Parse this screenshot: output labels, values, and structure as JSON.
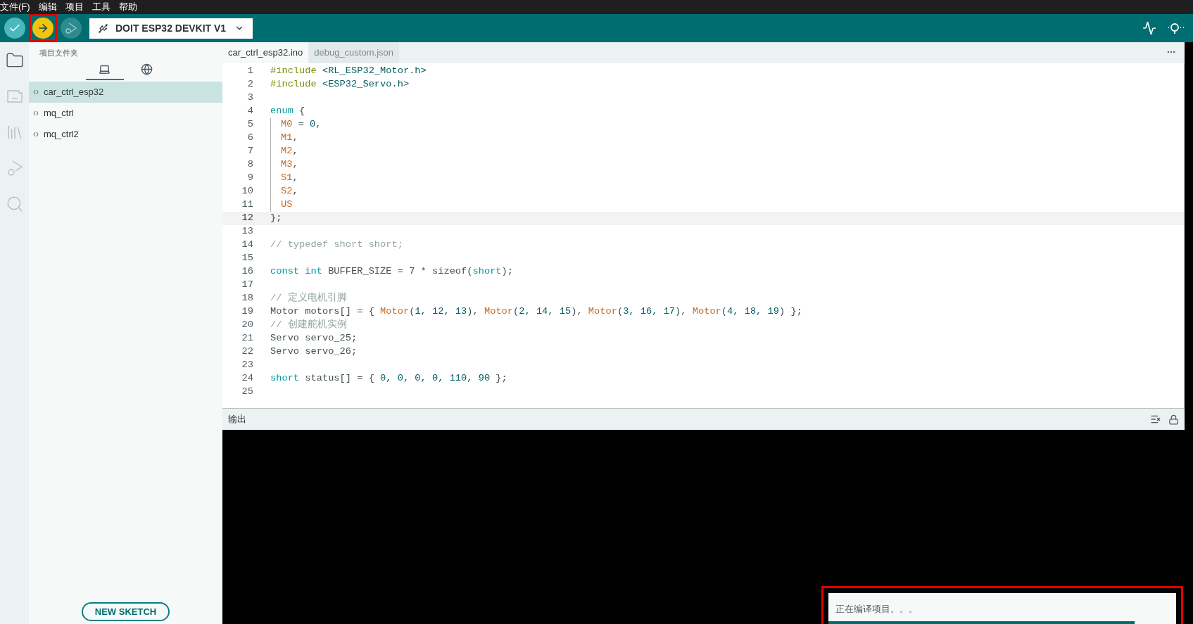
{
  "menu": [
    "文件(F)",
    "编辑",
    "项目",
    "工具",
    "帮助"
  ],
  "toolbar": {
    "buttons": [
      {
        "kind": "verify",
        "annotated": false
      },
      {
        "kind": "upload",
        "annotated": true
      },
      {
        "kind": "debug",
        "annotated": false
      }
    ],
    "board": "DOIT ESP32 DEVKIT V1"
  },
  "activity_bar": [
    {
      "kind": "folder",
      "selected": true
    },
    {
      "kind": "board",
      "selected": false
    },
    {
      "kind": "library",
      "selected": false
    },
    {
      "kind": "debug",
      "selected": false
    },
    {
      "kind": "search",
      "selected": false
    }
  ],
  "sidebar": {
    "title": "项目文件夹",
    "tabs": [
      {
        "kind": "local",
        "selected": true
      },
      {
        "kind": "cloud",
        "selected": false
      }
    ],
    "items": [
      {
        "label": "car_ctrl_esp32",
        "selected": true
      },
      {
        "label": "mq_ctrl",
        "selected": false
      },
      {
        "label": "mq_ctrl2",
        "selected": false
      }
    ],
    "new_button": "NEW SKETCH"
  },
  "editor": {
    "tabs": [
      {
        "label": "car_ctrl_esp32.ino",
        "selected": true
      },
      {
        "label": "debug_custom.json",
        "selected": false
      }
    ],
    "lines": [
      {
        "number": "1",
        "current": false,
        "indent": false,
        "tokens": [
          {
            "kind": "preproc",
            "text": "#include"
          },
          {
            "kind": "header",
            "text": " <RL_ESP32_Motor.h>"
          }
        ]
      },
      {
        "number": "2",
        "current": false,
        "indent": false,
        "tokens": [
          {
            "kind": "preproc",
            "text": "#include"
          },
          {
            "kind": "header",
            "text": " <ESP32_Servo.h>"
          }
        ]
      },
      {
        "number": "3",
        "current": false,
        "indent": false
      },
      {
        "number": "4",
        "current": false,
        "indent": false,
        "tokens": [
          {
            "kind": "keyword",
            "text": "enum"
          },
          {
            "kind": "plain",
            "text": " {"
          }
        ]
      },
      {
        "number": "5",
        "current": false,
        "indent": true,
        "tokens": [
          {
            "kind": "constant",
            "text": "M0"
          },
          {
            "kind": "plain",
            "text": " = "
          },
          {
            "kind": "number",
            "text": "0"
          },
          {
            "kind": "plain",
            "text": ","
          }
        ]
      },
      {
        "number": "6",
        "current": false,
        "indent": true,
        "tokens": [
          {
            "kind": "constant",
            "text": "M1"
          },
          {
            "kind": "plain",
            "text": ","
          }
        ]
      },
      {
        "number": "7",
        "current": false,
        "indent": true,
        "tokens": [
          {
            "kind": "constant",
            "text": "M2"
          },
          {
            "kind": "plain",
            "text": ","
          }
        ]
      },
      {
        "number": "8",
        "current": false,
        "indent": true,
        "tokens": [
          {
            "kind": "constant",
            "text": "M3"
          },
          {
            "kind": "plain",
            "text": ","
          }
        ]
      },
      {
        "number": "9",
        "current": false,
        "indent": true,
        "tokens": [
          {
            "kind": "constant",
            "text": "S1"
          },
          {
            "kind": "plain",
            "text": ","
          }
        ]
      },
      {
        "number": "10",
        "current": false,
        "indent": true,
        "tokens": [
          {
            "kind": "constant",
            "text": "S2"
          },
          {
            "kind": "plain",
            "text": ","
          }
        ]
      },
      {
        "number": "11",
        "current": false,
        "indent": true,
        "tokens": [
          {
            "kind": "constant",
            "text": "US"
          }
        ]
      },
      {
        "number": "12",
        "current": true,
        "indent": false,
        "tokens": [
          {
            "kind": "plain",
            "text": "};"
          }
        ]
      },
      {
        "number": "13",
        "current": false,
        "indent": false
      },
      {
        "number": "14",
        "current": false,
        "indent": false,
        "tokens": [
          {
            "kind": "comment",
            "text": "// typedef short short;"
          }
        ]
      },
      {
        "number": "15",
        "current": false,
        "indent": false
      },
      {
        "number": "16",
        "current": false,
        "indent": false,
        "tokens": [
          {
            "kind": "keyword",
            "text": "const int"
          },
          {
            "kind": "plain",
            "text": " BUFFER_SIZE = 7 * sizeof("
          },
          {
            "kind": "keyword",
            "text": "short"
          },
          {
            "kind": "plain",
            "text": ");"
          }
        ]
      },
      {
        "number": "17",
        "current": false,
        "indent": false
      },
      {
        "number": "18",
        "current": false,
        "indent": false,
        "tokens": [
          {
            "kind": "comment",
            "text": "// 定义电机引脚"
          }
        ]
      },
      {
        "number": "19",
        "current": false,
        "indent": false,
        "tokens": [
          {
            "kind": "plain",
            "text": "Motor motors[] = { "
          },
          {
            "kind": "constant",
            "text": "Motor"
          },
          {
            "kind": "plain",
            "text": "("
          },
          {
            "kind": "number",
            "text": "1, 12, 13"
          },
          {
            "kind": "plain",
            "text": "), "
          },
          {
            "kind": "constant",
            "text": "Motor"
          },
          {
            "kind": "plain",
            "text": "("
          },
          {
            "kind": "number",
            "text": "2, 14, 15"
          },
          {
            "kind": "plain",
            "text": "), "
          },
          {
            "kind": "constant",
            "text": "Motor"
          },
          {
            "kind": "plain",
            "text": "("
          },
          {
            "kind": "number",
            "text": "3, 16, 17"
          },
          {
            "kind": "plain",
            "text": "), "
          },
          {
            "kind": "constant",
            "text": "Motor"
          },
          {
            "kind": "plain",
            "text": "("
          },
          {
            "kind": "number",
            "text": "4, 18, 19"
          },
          {
            "kind": "plain",
            "text": ") };"
          }
        ]
      },
      {
        "number": "20",
        "current": false,
        "indent": false,
        "tokens": [
          {
            "kind": "comment",
            "text": "// 创建舵机实例"
          }
        ]
      },
      {
        "number": "21",
        "current": false,
        "indent": false,
        "tokens": [
          {
            "kind": "plain",
            "text": "Servo servo_25;"
          }
        ]
      },
      {
        "number": "22",
        "current": false,
        "indent": false,
        "tokens": [
          {
            "kind": "plain",
            "text": "Servo servo_26;"
          }
        ]
      },
      {
        "number": "23",
        "current": false,
        "indent": false
      },
      {
        "number": "24",
        "current": false,
        "indent": false,
        "tokens": [
          {
            "kind": "keyword",
            "text": "short"
          },
          {
            "kind": "plain",
            "text": " status[] = { "
          },
          {
            "kind": "number",
            "text": "0, 0, 0, 0, 110, 90"
          },
          {
            "kind": "plain",
            "text": " };"
          }
        ]
      },
      {
        "number": "25",
        "current": false,
        "indent": false
      }
    ]
  },
  "output": {
    "title": "输出"
  },
  "notification": {
    "text": "正在编译项目。。。",
    "level": 0.88,
    "annotated": true
  }
}
